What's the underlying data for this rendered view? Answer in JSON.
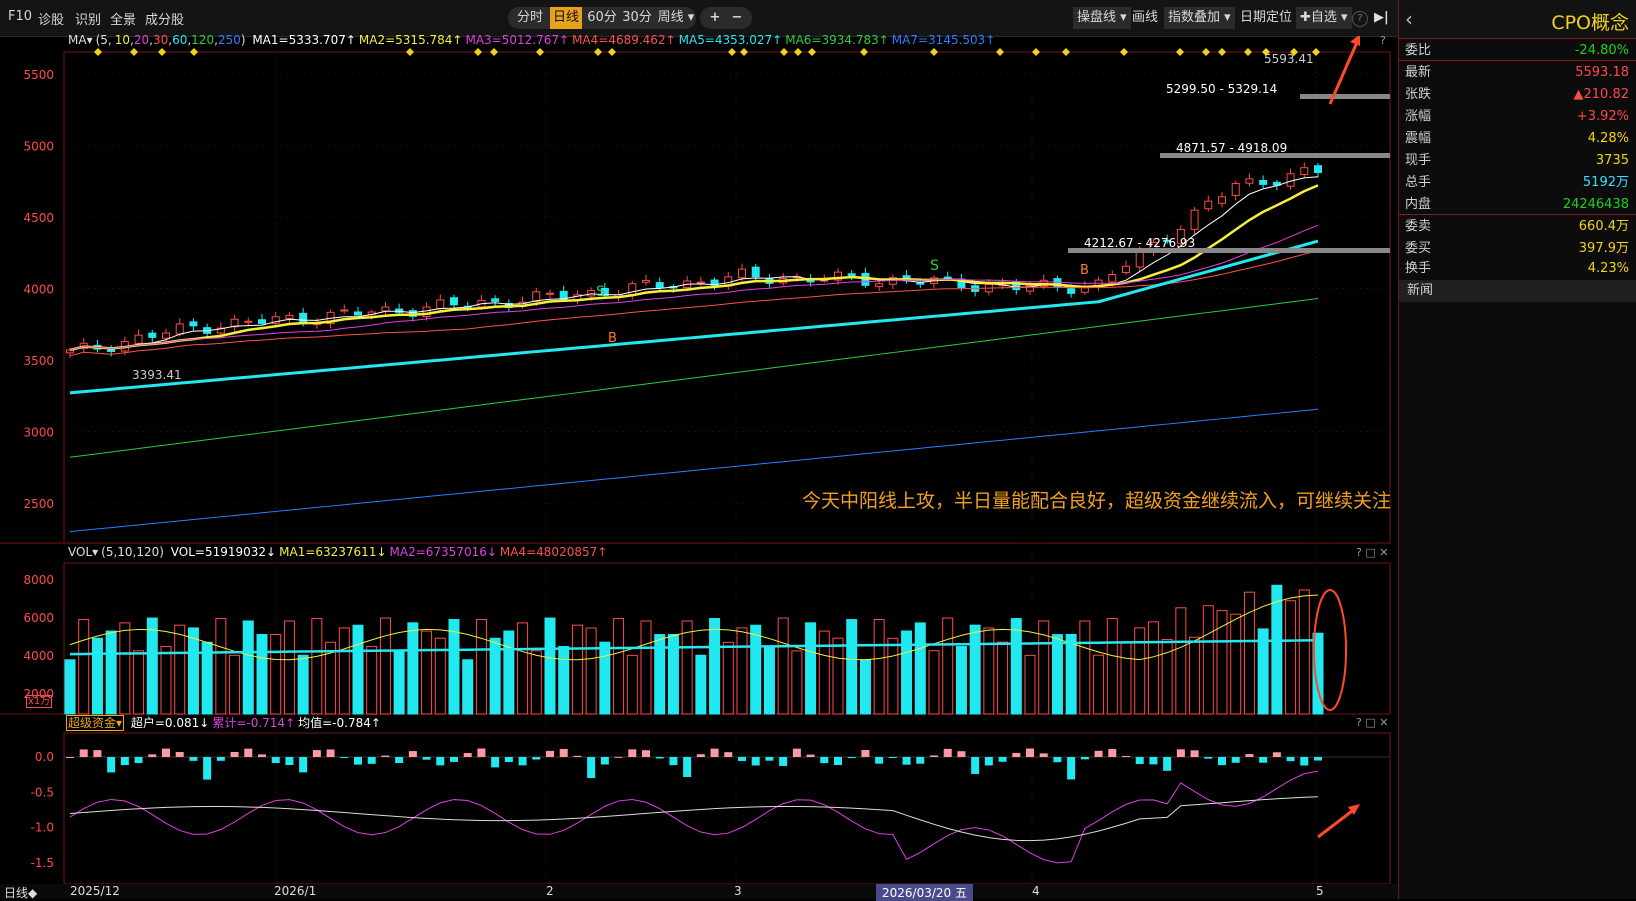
{
  "toolbar": {
    "f10": "F10",
    "diagnose": "诊股",
    "identify": "识别",
    "panorama": "全景",
    "components": "成分股",
    "periods": [
      "分时",
      "日线",
      "60分",
      "30分",
      "周线 ▾"
    ],
    "active_period": "日线",
    "zoom_in": "+",
    "zoom_out": "−",
    "trade_line": "操盘线 ▾",
    "draw": "画线",
    "index_overlay": "指数叠加 ▾",
    "date_locate": "日期定位",
    "watchlist": "✚自选 ▾",
    "help": "?",
    "collapse": "▶|"
  },
  "main_legend": {
    "name": "MA▾",
    "periods_prefix": "(5,",
    "periods": [
      "10",
      "20",
      "30",
      "60",
      "120",
      "250"
    ],
    "ma1": "MA1=5333.707↑",
    "ma2": "MA2=5315.784↑",
    "ma3": "MA3=5012.767↑",
    "ma4": "MA4=4689.462↑",
    "ma5": "MA5=4353.027↑",
    "ma6": "MA6=3934.783↑",
    "ma7": "MA7=3145.503↑"
  },
  "main_yaxis": [
    "5500",
    "5000",
    "4500",
    "4000",
    "3500",
    "3000",
    "2500"
  ],
  "main_labels": {
    "high": "5593.41",
    "range1": "5299.50 - 5329.14",
    "range2": "4871.57 - 4918.09",
    "range3": "4212.67 - 4276.93",
    "low": "3393.41",
    "signal_s": "S",
    "signal_b": "B"
  },
  "vol_legend": {
    "name": "VOL▾",
    "periods": "(5,10,120)",
    "vol": "VOL=51919032↓",
    "ma1": "MA1=63237611↓",
    "ma2": "MA2=67357016↓",
    "ma4": "MA4=48020857↑"
  },
  "vol_yaxis": [
    "8000",
    "6000",
    "4000",
    "2000"
  ],
  "vol_unit": "x1万",
  "fund_legend": {
    "name": "超级资金▾",
    "super": "超户=0.081↓",
    "cum": "累计=-0.714↑",
    "avg": "均值=-0.784↑"
  },
  "fund_yaxis": [
    "0.0",
    "-0.5",
    "-1.0",
    "-1.5"
  ],
  "pane_controls": "? □ ✕",
  "annotation": "今天中阳线上攻，半日量能配合良好，超级资金继续流入，可继续关注",
  "date_bar": {
    "mode": "日线◆",
    "labels": [
      "2025/12",
      "2026/1",
      "2",
      "3",
      "2026/03/20 五",
      "4",
      "5"
    ]
  },
  "side": {
    "title": "CPO概念",
    "back": "‹",
    "rows": [
      {
        "k": "委比",
        "v": "-24.80%",
        "c": "#1fd11f"
      },
      {
        "k": "最新",
        "v": "5593.18",
        "c": "#ff4a4a"
      },
      {
        "k": "张跌",
        "v": "▲210.82",
        "c": "#ff4a4a"
      },
      {
        "k": "涨幅",
        "v": "+3.92%",
        "c": "#ff4a4a"
      },
      {
        "k": "震幅",
        "v": "4.28%",
        "c": "#f2d21b"
      },
      {
        "k": "现手",
        "v": "3735",
        "c": "#f2d21b"
      },
      {
        "k": "总手",
        "v": "5192万",
        "c": "#3ee0ff"
      },
      {
        "k": "内盘",
        "v": "24246438",
        "c": "#1fd11f"
      },
      {
        "k": "委卖",
        "v": "660.4万",
        "c": "#f2d21b"
      },
      {
        "k": "委买",
        "v": "397.9万",
        "c": "#f2d21b"
      },
      {
        "k": "换手",
        "v": "4.23%",
        "c": "#f2d21b"
      }
    ],
    "news": "新闻"
  },
  "colors": {
    "up": "#ff4a4a",
    "down": "#22e8f0",
    "ma5": "#ffffff",
    "ma10": "#f6ef3a",
    "ma20": "#e040e0",
    "ma30": "#ff5050",
    "ma60": "#22e8f0",
    "ma120": "#2ecc40",
    "ma250": "#2a7fff"
  }
}
